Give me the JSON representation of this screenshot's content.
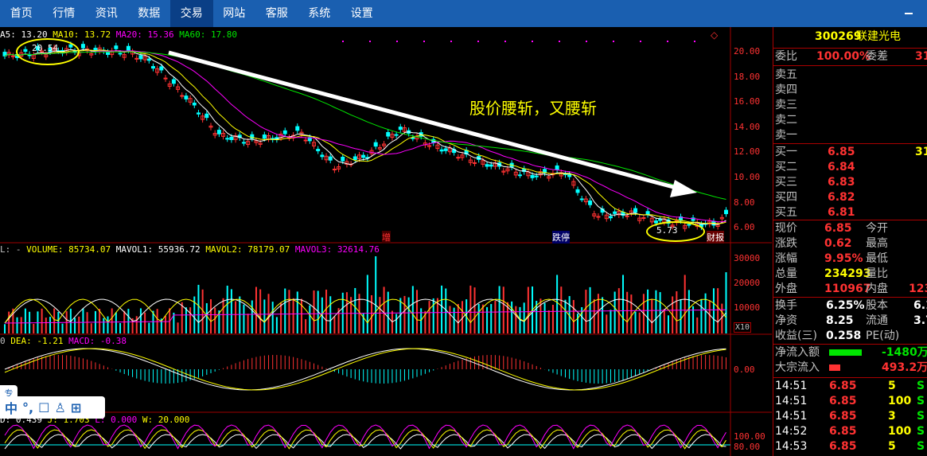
{
  "menu": {
    "items": [
      "首页",
      "行情",
      "资讯",
      "数据",
      "交易",
      "网站",
      "客服",
      "系统",
      "设置"
    ],
    "active_index": 4
  },
  "main_chart": {
    "ma_legend": {
      "ma5": "A5: 13.20",
      "ma10": "MA10: 13.72",
      "ma20": "MA20: 15.36",
      "ma60": "MA60: 17.80"
    },
    "y_ticks": [
      "20.00",
      "18.00",
      "16.00",
      "14.00",
      "12.00",
      "10.00",
      "8.00",
      "6.00"
    ],
    "annotation": "股价腰斩，又腰斩",
    "high_label": "20.54",
    "low_label": "5.73",
    "markers": {
      "increase": "增",
      "limit_down": "跌停",
      "financial_report": "财报"
    },
    "diamond": "◇"
  },
  "volume_chart": {
    "legend": {
      "prefix": "L: -",
      "volume": "VOLUME: 85734.07",
      "mavol1": "MAVOL1: 55936.72",
      "mavol2": "MAVOL2: 78179.07",
      "mavol3": "MAVOL3: 32614.76"
    },
    "y_ticks": [
      "30000",
      "20000",
      "10000"
    ],
    "unit": "X10"
  },
  "macd_chart": {
    "legend": {
      "prefix": "0",
      "dea": "DEA: -1.21",
      "macd": "MACD: -0.38"
    },
    "y_ticks": [
      "0.00"
    ]
  },
  "kdj_chart": {
    "legend": {
      "k": "D: 0.439",
      "d": "J: 1.703",
      "j": "L: 0.000",
      "w": "W: 20.000"
    },
    "y_ticks": [
      "100.00",
      "80.00"
    ]
  },
  "toolbar": {
    "items": [
      "中",
      "°,",
      "☐",
      "♙",
      "⊞"
    ],
    "side_tab": "专"
  },
  "quote": {
    "code": "300269",
    "name": "联建光电",
    "weibi_label": "委比",
    "weibi_value": "100.00%",
    "weicha_label": "委差",
    "weicha_value": "31",
    "sell": [
      {
        "label": "卖五",
        "price": "",
        "vol": ""
      },
      {
        "label": "卖四",
        "price": "",
        "vol": ""
      },
      {
        "label": "卖三",
        "price": "",
        "vol": ""
      },
      {
        "label": "卖二",
        "price": "",
        "vol": ""
      },
      {
        "label": "卖一",
        "price": "",
        "vol": ""
      }
    ],
    "buy": [
      {
        "label": "买一",
        "price": "6.85",
        "vol": "31"
      },
      {
        "label": "买二",
        "price": "6.84",
        "vol": ""
      },
      {
        "label": "买三",
        "price": "6.83",
        "vol": ""
      },
      {
        "label": "买四",
        "price": "6.82",
        "vol": ""
      },
      {
        "label": "买五",
        "price": "6.81",
        "vol": ""
      }
    ],
    "stats": [
      {
        "l1": "现价",
        "v1": "6.85",
        "c1": "red",
        "l2": "今开",
        "v2": ""
      },
      {
        "l1": "涨跌",
        "v1": "0.62",
        "c1": "red",
        "l2": "最高",
        "v2": ""
      },
      {
        "l1": "涨幅",
        "v1": "9.95%",
        "c1": "red",
        "l2": "最低",
        "v2": ""
      },
      {
        "l1": "总量",
        "v1": "234293",
        "c1": "yel",
        "l2": "量比",
        "v2": ""
      },
      {
        "l1": "外盘",
        "v1": "110967",
        "c1": "red",
        "l2": "内盘",
        "v2": "123"
      }
    ],
    "stats2": [
      {
        "l1": "换手",
        "v1": "6.25%",
        "l2": "股本",
        "v2": "6.1"
      },
      {
        "l1": "净资",
        "v1": "8.25",
        "l2": "流通",
        "v2": "3.7"
      },
      {
        "l1": "收益(三)",
        "v1": "0.258",
        "l2": "PE(动)",
        "v2": ""
      }
    ],
    "flow": [
      {
        "label": "净流入额",
        "value": "-1480万",
        "bar_color": "#00e600",
        "bar_fraction": 0.9,
        "value_color": "#00e600"
      },
      {
        "label": "大宗流入",
        "value": "493.2万",
        "bar_color": "#ff3232",
        "bar_fraction": 0.3,
        "value_color": "#ff3232"
      }
    ],
    "ticks": [
      {
        "time": "14:51",
        "price": "6.85",
        "vol": "5",
        "dir": "S"
      },
      {
        "time": "14:51",
        "price": "6.85",
        "vol": "100",
        "dir": "S"
      },
      {
        "time": "14:51",
        "price": "6.85",
        "vol": "3",
        "dir": "S"
      },
      {
        "time": "14:52",
        "price": "6.85",
        "vol": "100",
        "dir": "S"
      },
      {
        "time": "14:53",
        "price": "6.85",
        "vol": "5",
        "dir": "S"
      }
    ]
  },
  "colors": {
    "menubar": "#1a5fb0",
    "up": "#ff3232",
    "down": "#00ffff",
    "ma5": "#ffffff",
    "ma10": "#ffff00",
    "ma20": "#ff00ff",
    "ma60": "#00e600",
    "grid_border": "#a00000"
  }
}
